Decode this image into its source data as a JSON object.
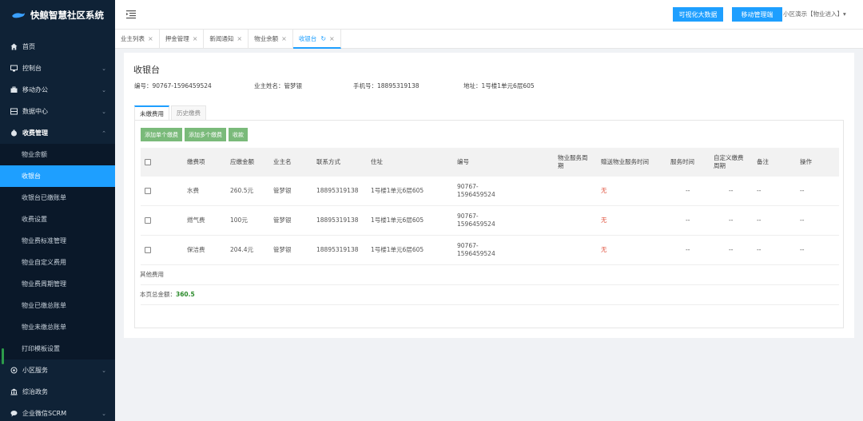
{
  "app": {
    "title": "快鲸智慧社区系统"
  },
  "sidebar": {
    "items": [
      {
        "label": "首页",
        "icon": "home-icon",
        "chevron": false
      },
      {
        "label": "控制台",
        "icon": "monitor-icon",
        "chevron": true
      },
      {
        "label": "移动办公",
        "icon": "briefcase-icon",
        "chevron": true
      },
      {
        "label": "数据中心",
        "icon": "database-icon",
        "chevron": true
      },
      {
        "label": "收费管理",
        "icon": "money-icon",
        "chevron": true,
        "expanded": true
      }
    ],
    "submenu": [
      {
        "label": "物业余额",
        "active": false
      },
      {
        "label": "收银台",
        "active": true
      },
      {
        "label": "收银台已缴账单",
        "active": false
      },
      {
        "label": "收费设置",
        "active": false
      },
      {
        "label": "物业费标准管理",
        "active": false
      },
      {
        "label": "物业自定义费用",
        "active": false
      },
      {
        "label": "物业费周期管理",
        "active": false
      },
      {
        "label": "物业已缴总账单",
        "active": false
      },
      {
        "label": "物业未缴总账单",
        "active": false
      },
      {
        "label": "打印模板设置",
        "active": false
      }
    ],
    "items_after": [
      {
        "label": "小区服务",
        "icon": "community-icon",
        "chevron": true
      },
      {
        "label": "综治政务",
        "icon": "bank-icon",
        "chevron": false
      },
      {
        "label": "企业微信SCRM",
        "icon": "chat-icon",
        "chevron": true
      }
    ]
  },
  "topbar": {
    "btn_bigdata": "可视化大数据",
    "btn_mobile": "移动管理端",
    "user": "小区演示【物业进入】▾"
  },
  "tabs": [
    {
      "label": "业主列表",
      "active": false
    },
    {
      "label": "押金管理",
      "active": false
    },
    {
      "label": "新闻通知",
      "active": false
    },
    {
      "label": "物业余额",
      "active": false
    },
    {
      "label": "收银台",
      "active": true
    }
  ],
  "page": {
    "title": "收银台",
    "info": {
      "code": "编号：90767-1596459524",
      "owner": "业主姓名：管梦银",
      "phone": "手机号：18895319138",
      "address": "地址：1号楼1单元6层605"
    },
    "subtabs": [
      "未缴费用",
      "历史缴费"
    ],
    "buttons": {
      "add_single": "添加单个缴费",
      "add_multi": "添加多个缴费",
      "pay": "收款"
    },
    "table": {
      "headers": [
        "缴费项",
        "应缴金额",
        "业主名",
        "联系方式",
        "住址",
        "编号",
        "物业服务周期",
        "赠送物业服务时间",
        "服务时间",
        "自定义缴费周期",
        "备注",
        "操作"
      ],
      "rows": [
        {
          "item": "水费",
          "amount": "260.5元",
          "owner": "管梦银",
          "phone": "18895319138",
          "addr": "1号楼1单元6层605",
          "code1": "90767-",
          "code2": "1596459524",
          "gift": "无",
          "time": "--",
          "custom": "--",
          "note": "--",
          "op": "--"
        },
        {
          "item": "燃气费",
          "amount": "100元",
          "owner": "管梦银",
          "phone": "18895319138",
          "addr": "1号楼1单元6层605",
          "code1": "90767-",
          "code2": "1596459524",
          "gift": "无",
          "time": "--",
          "custom": "--",
          "note": "--",
          "op": "--"
        },
        {
          "item": "保洁费",
          "amount": "204.4元",
          "owner": "管梦银",
          "phone": "18895319138",
          "addr": "1号楼1单元6层605",
          "code1": "90767-",
          "code2": "1596459524",
          "gift": "无",
          "time": "--",
          "custom": "--",
          "note": "--",
          "op": "--"
        }
      ],
      "other_label": "其他费用",
      "total_label": "本页总金额：",
      "total_value": "360.5"
    }
  }
}
